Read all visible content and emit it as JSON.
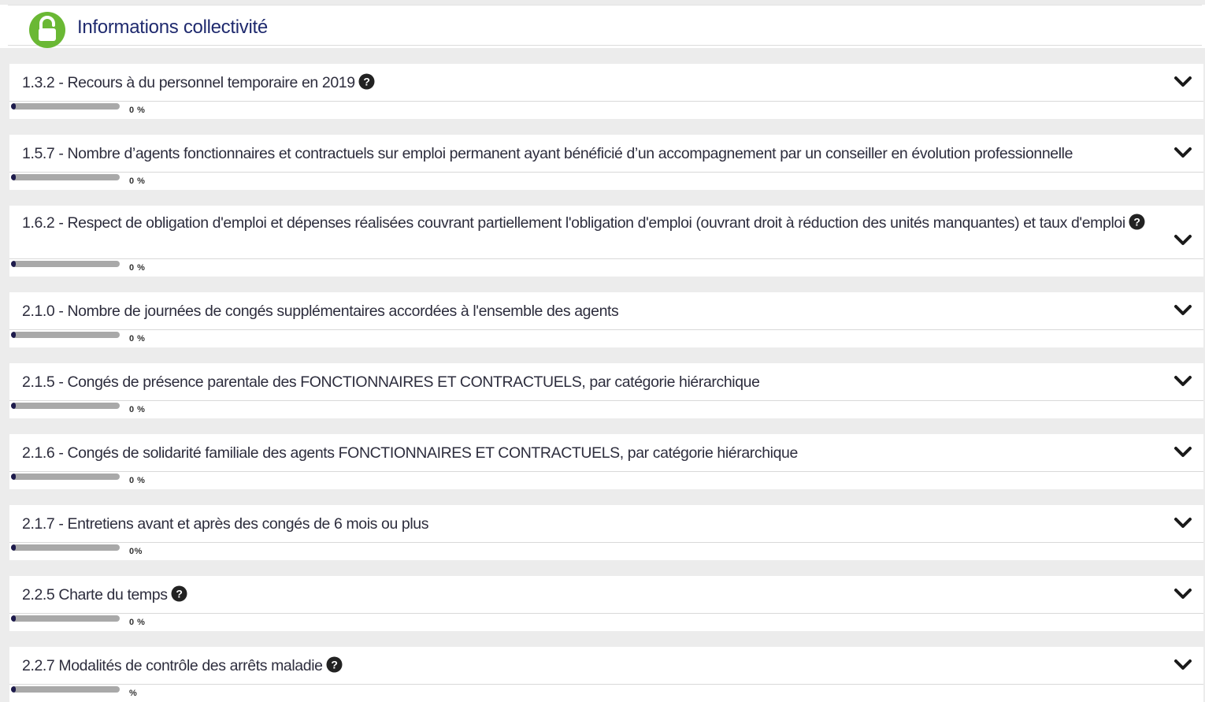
{
  "header": {
    "title": "Informations collectivité",
    "icon": "lock-open-icon",
    "icon_color": "#6ab834"
  },
  "items": [
    {
      "title": "1.3.2 - Recours à du personnel temporaire en 2019",
      "help": true,
      "progress": 0,
      "progress_label": "0 %"
    },
    {
      "title": "1.5.7 - Nombre d’agents fonctionnaires et contractuels sur emploi permanent ayant bénéficié d’un accompagnement par un conseiller en évolution professionnelle",
      "help": false,
      "progress": 0,
      "progress_label": "0 %"
    },
    {
      "title": "1.6.2 - Respect de obligation d'emploi et dépenses réalisées couvrant partiellement l'obligation d'emploi (ouvrant droit à réduction des unités manquantes) et taux d'emploi",
      "help": true,
      "progress": 0,
      "progress_label": "0 %"
    },
    {
      "title": "2.1.0 - Nombre de journées de congés supplémentaires accordées à l'ensemble des agents",
      "help": false,
      "progress": 0,
      "progress_label": "0 %"
    },
    {
      "title": "2.1.5 - Congés de présence parentale des FONCTIONNAIRES ET CONTRACTUELS, par catégorie hiérarchique",
      "help": false,
      "progress": 0,
      "progress_label": "0 %"
    },
    {
      "title": "2.1.6 - Congés de solidarité familiale des agents FONCTIONNAIRES ET CONTRACTUELS, par catégorie hiérarchique",
      "help": false,
      "progress": 0,
      "progress_label": "0 %"
    },
    {
      "title": "2.1.7 - Entretiens avant et après des congés de 6 mois ou plus",
      "help": false,
      "progress": 0,
      "progress_label": "0%"
    },
    {
      "title": "2.2.5 Charte du temps",
      "help": true,
      "progress": 0,
      "progress_label": "0 %"
    },
    {
      "title": "2.2.7 Modalités de contrôle des arrêts maladie",
      "help": true,
      "progress": 0,
      "progress_label": "%"
    }
  ],
  "colors": {
    "accent_dark": "#1d1b4c",
    "progress_track": "#a9a9a9",
    "section_bg": "#ececec"
  }
}
